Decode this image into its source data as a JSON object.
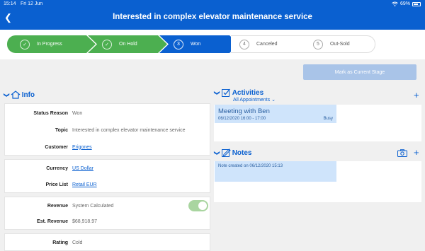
{
  "status_bar": {
    "time": "15:14",
    "date": "Fri 12 Jun",
    "battery": "69%"
  },
  "header": {
    "title": "Interested in complex elevator maintenance service",
    "back_symbol": "❮"
  },
  "process": {
    "stages": [
      {
        "number": "✓",
        "label": "In Progress",
        "state": "done"
      },
      {
        "number": "✓",
        "label": "On Hold",
        "state": "done"
      },
      {
        "number": "3",
        "label": "Won",
        "state": "current"
      },
      {
        "number": "4",
        "label": "Canceled",
        "state": "todo"
      },
      {
        "number": "5",
        "label": "Out-Sold",
        "state": "todo"
      }
    ],
    "mark_button": "Mark as Current Stage"
  },
  "info": {
    "title": "Info",
    "status_reason": {
      "label": "Status Reason",
      "value": "Won"
    },
    "topic": {
      "label": "Topic",
      "value": "Interested in complex elevator maintenance service"
    },
    "customer": {
      "label": "Customer",
      "value": "Erigones"
    },
    "currency": {
      "label": "Currency",
      "value": "US Dollar"
    },
    "price_list": {
      "label": "Price List",
      "value": "Retail EUR"
    },
    "revenue": {
      "label": "Revenue",
      "value": "System Calculated",
      "toggle_on": true
    },
    "est_revenue": {
      "label": "Est. Revenue",
      "value": "$68,918.97"
    },
    "rating": {
      "label": "Rating",
      "value": "Cold"
    }
  },
  "activities": {
    "title": "Activities",
    "filter": "All Appointments ⌄",
    "items": [
      {
        "title": "Meeting with Ben",
        "date": "06/12/2020 16:00 - 17:00",
        "status": "Busy"
      }
    ]
  },
  "notes": {
    "title": "Notes",
    "items": [
      {
        "text": "Note created on 06/12/2020 15:13"
      }
    ]
  },
  "colors": {
    "accent": "#0a60d0",
    "done": "#4caf50",
    "mark_button": "#a9c4e8",
    "tile": "#cfe4fb"
  }
}
